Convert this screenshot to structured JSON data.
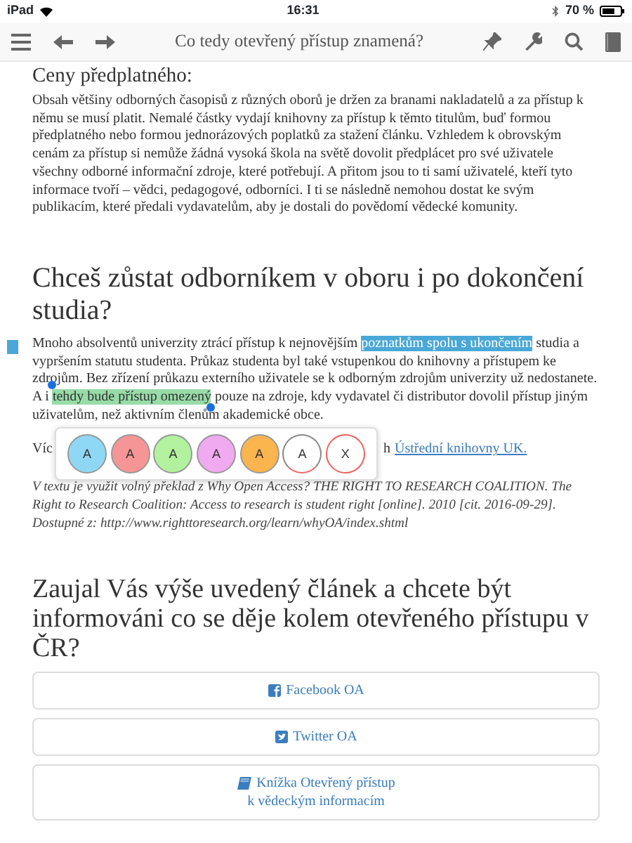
{
  "status_bar": {
    "device": "iPad",
    "time": "16:31",
    "battery": "70 %"
  },
  "toolbar": {
    "title": "Co tedy otevřený přístup znamená?"
  },
  "section1": {
    "heading": "Ceny předplatného:",
    "paragraph": "Obsah většiny odborných časopisů z různých oborů je držen za branami nakladatelů a za přístup k němu se musí platit. Nemalé částky vydají knihovny za přístup k těmto titulům, buď formou předplatného nebo formou jednorázových poplatků za stažení článku. Vzhledem k obrovským cenám za přístup si nemůže žádná vysoká škola na světě dovolit předplácet pro své uživatele všechny odborné informační zdroje, které potřebují. A přitom jsou to ti samí uživatelé, kteří tyto informace tvoří – vědci, pedagogové, odborníci. I ti se následně nemohou dostat ke svým publikacím, které předali vydavatelům, aby je dostali do povědomí vědecké komunity."
  },
  "section2": {
    "heading": "Chceš zůstat odborníkem v oboru i po dokončení studia?",
    "paragraph": [
      {
        "text": "Mnoho absolventů univerzity ztrácí přístup k nejnovějším ",
        "kind": "plain"
      },
      {
        "text": "poznatkům spolu s ukončením",
        "kind": "selection"
      },
      {
        "text": " studia a vypršením statutu studenta. Průkaz studenta byl také vstupenkou do knihovny a přístupem ke zdrojům. Bez zřízení průkazu externího uživatele se k odborným zdrojům univerzity už nedostanete. A i ",
        "kind": "plain"
      },
      {
        "text": "tehdy bude přístup omezený",
        "kind": "highlight"
      },
      {
        "text": " pouze na zdroje, kdy vydavatel či distributor dovolil přístup jiným uživatelům, než aktivním členům akademické obce.",
        "kind": "plain"
      }
    ],
    "note_marker": true,
    "more_start": "Víc",
    "more_end": "h",
    "more_link": "Ústřední knihovny UK.",
    "citation": "V textu je využit volný překlad z Why Open Access? THE RIGHT TO RESEARCH COALITION. The Right to Research Coalition: Access to research is student right [online]. 2010 [cit. 2016-09-29]. Dostupné z: http://www.righttoresearch.org/learn/whyOA/index.shtml"
  },
  "highlight_menu": [
    {
      "label": "A",
      "kind": "color",
      "color": "#8fd8f5"
    },
    {
      "label": "A",
      "kind": "color",
      "color": "#f59595"
    },
    {
      "label": "A",
      "kind": "color",
      "color": "#b2f29e"
    },
    {
      "label": "A",
      "kind": "color",
      "color": "#efaaf0"
    },
    {
      "label": "A",
      "kind": "color",
      "color": "#fbb54f"
    },
    {
      "label": "A",
      "kind": "underline"
    },
    {
      "label": "X",
      "kind": "remove"
    }
  ],
  "section3": {
    "heading": "Zaujal Vás výše uvedený článek a chcete být informováni co se děje kolem otevřeného přístupu v ČR?",
    "buttons": [
      {
        "kind": "facebook",
        "lines": [
          "Facebook OA"
        ]
      },
      {
        "kind": "twitter",
        "lines": [
          "Twitter OA"
        ]
      },
      {
        "kind": "book",
        "lines": [
          "Knížka Otevřený přístup",
          "k vědeckým informacím"
        ]
      }
    ]
  }
}
